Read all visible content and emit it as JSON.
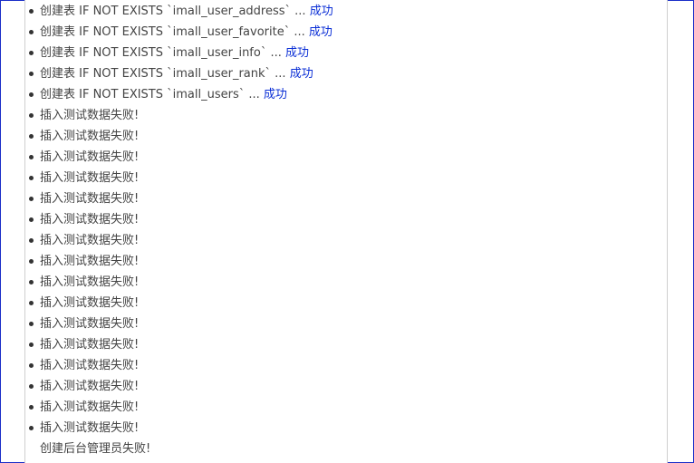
{
  "log": {
    "items": [
      {
        "text": "创建表 IF NOT EXISTS `imall_user_address` ... ",
        "status": "成功",
        "bullet": true
      },
      {
        "text": "创建表 IF NOT EXISTS `imall_user_favorite` ... ",
        "status": "成功",
        "bullet": true
      },
      {
        "text": "创建表 IF NOT EXISTS `imall_user_info` ... ",
        "status": "成功",
        "bullet": true
      },
      {
        "text": "创建表 IF NOT EXISTS `imall_user_rank` ... ",
        "status": "成功",
        "bullet": true
      },
      {
        "text": "创建表 IF NOT EXISTS `imall_users` ... ",
        "status": "成功",
        "bullet": true
      },
      {
        "text": "插入测试数据失败!",
        "status": "",
        "bullet": true
      },
      {
        "text": "插入测试数据失败!",
        "status": "",
        "bullet": true
      },
      {
        "text": "插入测试数据失败!",
        "status": "",
        "bullet": true
      },
      {
        "text": "插入测试数据失败!",
        "status": "",
        "bullet": true
      },
      {
        "text": "插入测试数据失败!",
        "status": "",
        "bullet": true
      },
      {
        "text": "插入测试数据失败!",
        "status": "",
        "bullet": true
      },
      {
        "text": "插入测试数据失败!",
        "status": "",
        "bullet": true
      },
      {
        "text": "插入测试数据失败!",
        "status": "",
        "bullet": true
      },
      {
        "text": "插入测试数据失败!",
        "status": "",
        "bullet": true
      },
      {
        "text": "插入测试数据失败!",
        "status": "",
        "bullet": true
      },
      {
        "text": "插入测试数据失败!",
        "status": "",
        "bullet": true
      },
      {
        "text": "插入测试数据失败!",
        "status": "",
        "bullet": true
      },
      {
        "text": "插入测试数据失败!",
        "status": "",
        "bullet": true
      },
      {
        "text": "插入测试数据失败!",
        "status": "",
        "bullet": true
      },
      {
        "text": "插入测试数据失败!",
        "status": "",
        "bullet": true
      },
      {
        "text": "插入测试数据失败!",
        "status": "",
        "bullet": true
      },
      {
        "text": "创建后台管理员失败!",
        "status": "",
        "bullet": false
      }
    ]
  },
  "colors": {
    "text": "#444444",
    "success": "#0b2fd6",
    "frame": "#1a2ec8",
    "panel_border": "#cfcfcf"
  }
}
